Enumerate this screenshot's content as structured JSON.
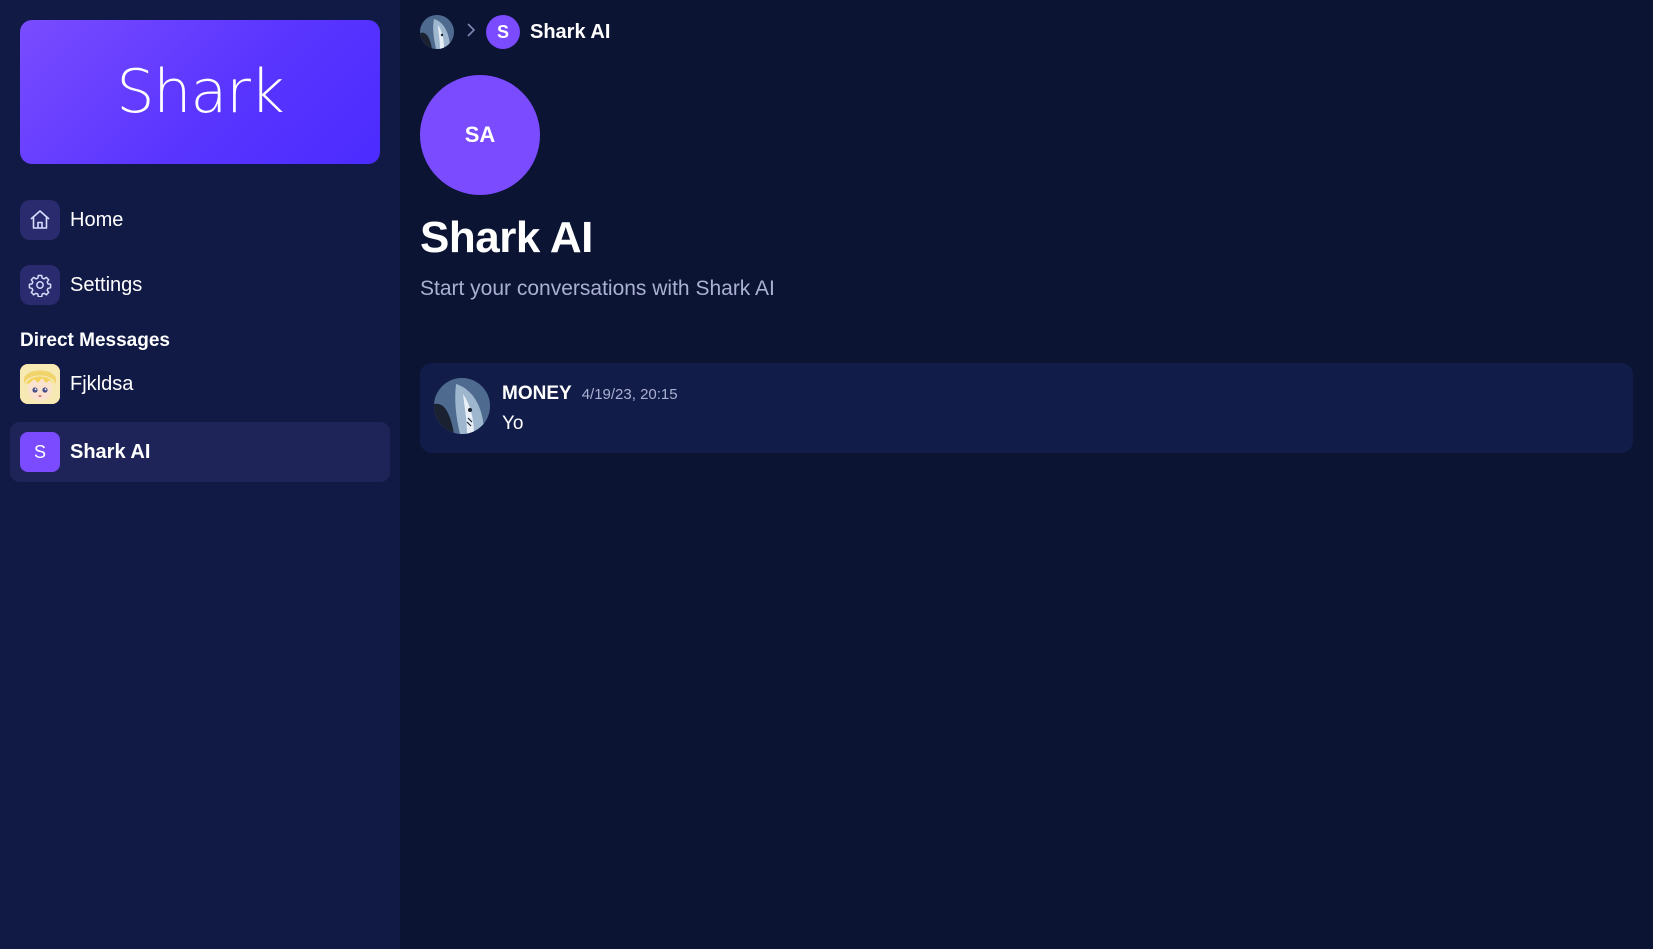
{
  "sidebar": {
    "brand": "Shark",
    "nav": [
      {
        "label": "Home",
        "icon": "home-icon"
      },
      {
        "label": "Settings",
        "icon": "gear-icon"
      }
    ],
    "dm_title": "Direct Messages",
    "dms": [
      {
        "label": "Fjkldsa",
        "avatar": "anime-avatar"
      },
      {
        "label": "Shark AI",
        "avatar_letter": "S",
        "active": true
      }
    ]
  },
  "header": {
    "crumb_letter": "S",
    "crumb_name": "Shark AI"
  },
  "profile": {
    "initials": "SA",
    "title": "Shark AI",
    "subtitle": "Start your conversations with Shark AI"
  },
  "messages": [
    {
      "author": "MONEY",
      "time": "4/19/23, 20:15",
      "text": "Yo"
    }
  ],
  "colors": {
    "accent": "#7b4bff",
    "background": "#0c1434",
    "sidebar": "#111a45",
    "card": "#121c48"
  }
}
